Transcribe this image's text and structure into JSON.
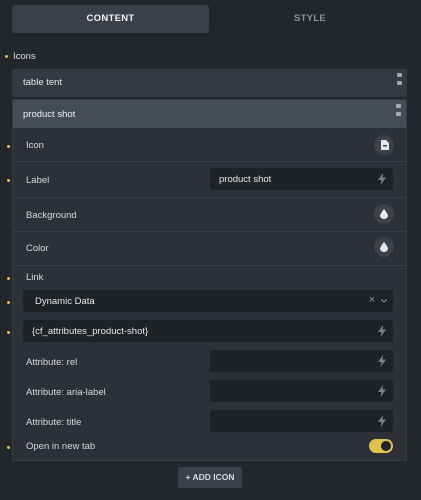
{
  "tabs": {
    "content": "CONTENT",
    "style": "STYLE"
  },
  "icons_section": {
    "label": "Icons",
    "items": [
      {
        "title": "table tent"
      },
      {
        "title": "product shot"
      }
    ]
  },
  "item_panel": {
    "icon_label": "Icon",
    "label_label": "Label",
    "label_value": "product shot",
    "background_label": "Background",
    "color_label": "Color",
    "link_label": "Link",
    "link_type": "Dynamic Data",
    "link_value": "{cf_attributes_product-shot}",
    "attr_rel_label": "Attribute: rel",
    "attr_rel_value": "",
    "attr_aria_label": "Attribute: aria-label",
    "attr_aria_value": "",
    "attr_title_label": "Attribute: title",
    "attr_title_value": "",
    "new_tab_label": "Open in new tab",
    "new_tab_on": true
  },
  "add_button": {
    "plus": "+",
    "label": "ADD ICON"
  },
  "colors": {
    "accent": "#e0c24e",
    "panel": "#2d3137",
    "header": "#464c55"
  }
}
